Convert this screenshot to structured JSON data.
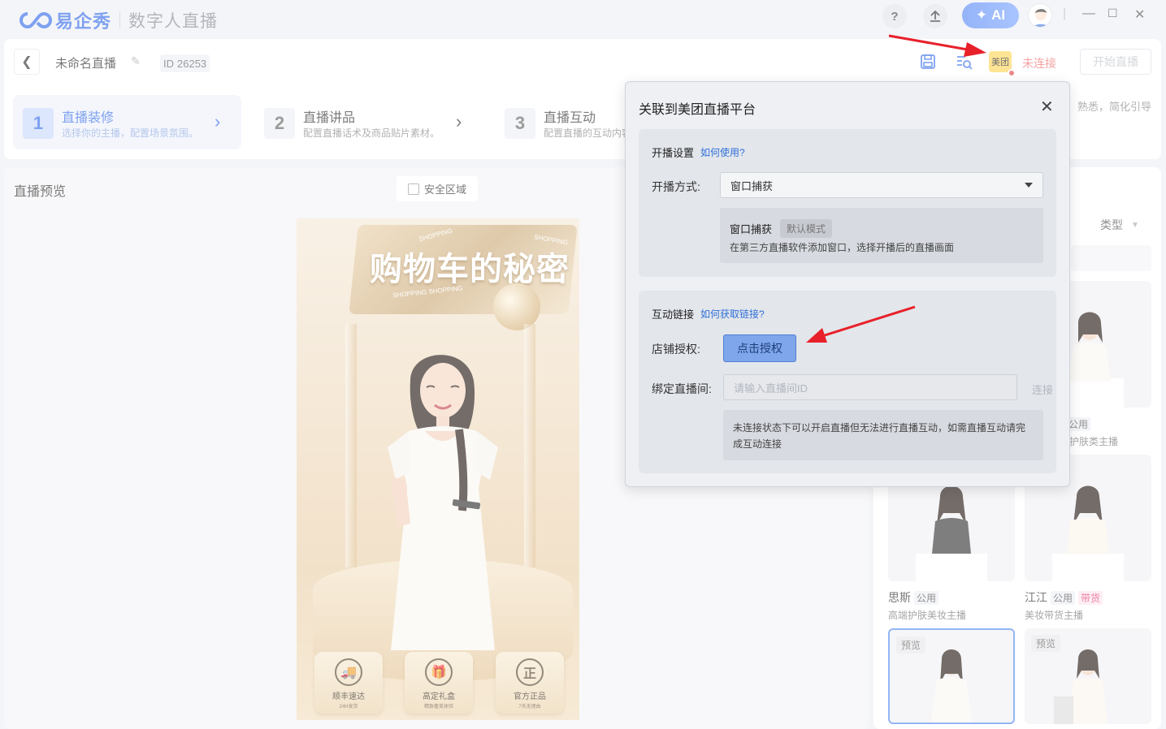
{
  "app": {
    "brand": "易企秀",
    "product": "数字人直播",
    "help_label": "?",
    "ai_label": "AI"
  },
  "header": {
    "stream_name": "未命名直播",
    "id_prefix": "ID",
    "id_value": "26253",
    "platform_badge": "美团",
    "connection_status": "未连接",
    "start_button": "开始直播",
    "right_hint": "熟悉，简化引导"
  },
  "steps": [
    {
      "num": "1",
      "title": "直播装修",
      "desc": "选择你的主播，配置场景氛围。"
    },
    {
      "num": "2",
      "title": "直播讲品",
      "desc": "配置直播话术及商品贴片素材。"
    },
    {
      "num": "3",
      "title": "直播互动",
      "desc": "配置直播的互动内容"
    }
  ],
  "preview": {
    "title": "直播预览",
    "safe_area_label": "安全区域",
    "banner_text": "购物车的秘密",
    "banner_small_1": "SHOPPING",
    "banner_small_2": "SHOPPING",
    "banner_small_3": "SHOPPING SHOPPING",
    "features": [
      {
        "icon": "truck-icon",
        "label": "顺丰速达",
        "sub": "24H发货"
      },
      {
        "icon": "gift-icon",
        "label": "高定礼盒",
        "sub": "精致奢美体验"
      },
      {
        "icon": "genuine-icon",
        "label": "官方正品",
        "sub": "7天无理由"
      }
    ]
  },
  "right_panel": {
    "type_filter": "类型",
    "avatars": [
      {
        "name": "",
        "tags": [
          "公用"
        ],
        "desc": "护肤类主播"
      },
      {
        "name": "思斯",
        "tags": [
          "公用"
        ],
        "desc": "高端护肤美妆主播"
      },
      {
        "name": "江江",
        "tags": [
          "公用",
          "带货"
        ],
        "desc": "美妆带货主播"
      },
      {
        "preview_tag": "预览"
      },
      {
        "preview_tag": "预览"
      }
    ]
  },
  "dialog": {
    "title": "关联到美团直播平台",
    "section1": {
      "heading": "开播设置",
      "help_link": "如何使用?",
      "method_label": "开播方式:",
      "method_value": "窗口捕获",
      "mode_title": "窗口捕获",
      "mode_tag": "默认模式",
      "mode_desc": "在第三方直播软件添加窗口，选择开播后的直播画面"
    },
    "section2": {
      "heading": "互动链接",
      "help_link": "如何获取链接?",
      "auth_label": "店铺授权:",
      "auth_button": "点击授权",
      "bind_label": "绑定直播间:",
      "bind_placeholder": "请输入直播间ID",
      "connect_label": "连接",
      "note": "未连接状态下可以开启直播但无法进行直播互动，如需直播互动请完成互动连接"
    }
  },
  "colors": {
    "accent": "#3a6fe8",
    "status_red": "#f07070",
    "arrow_red": "#e8202a",
    "meituan_yellow": "#ffd65c"
  }
}
